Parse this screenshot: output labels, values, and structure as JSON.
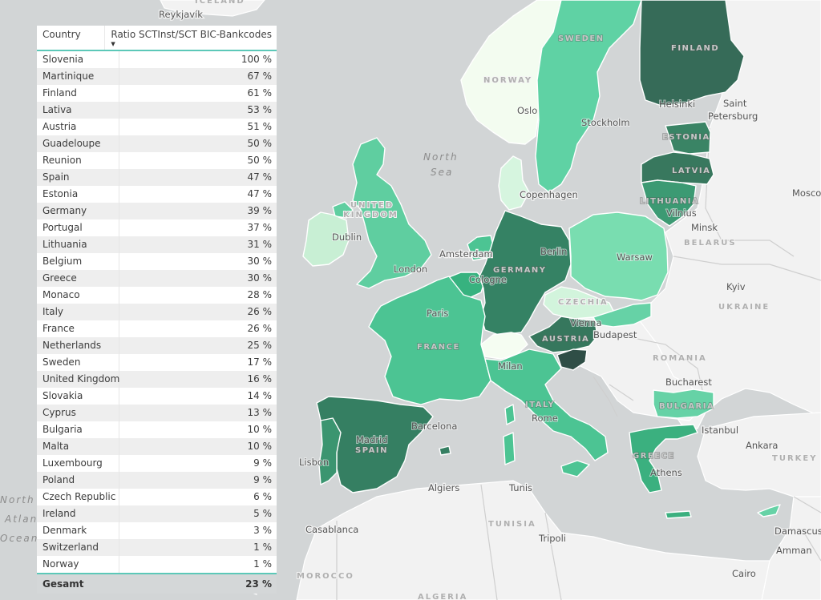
{
  "table": {
    "columns": [
      "Country",
      "Ratio SCTInst/SCT BIC-Bankcodes"
    ],
    "sort_indicator": "sort-descending-icon",
    "rows": [
      {
        "country": "Slovenia",
        "ratio": "100 %"
      },
      {
        "country": "Martinique",
        "ratio": "67 %"
      },
      {
        "country": "Finland",
        "ratio": "61 %"
      },
      {
        "country": "Lativa",
        "ratio": "53 %"
      },
      {
        "country": "Austria",
        "ratio": "51 %"
      },
      {
        "country": "Guadeloupe",
        "ratio": "50 %"
      },
      {
        "country": "Reunion",
        "ratio": "50 %"
      },
      {
        "country": "Spain",
        "ratio": "47 %"
      },
      {
        "country": "Estonia",
        "ratio": "47 %"
      },
      {
        "country": "Germany",
        "ratio": "39 %"
      },
      {
        "country": "Portugal",
        "ratio": "37 %"
      },
      {
        "country": "Lithuania",
        "ratio": "31 %"
      },
      {
        "country": "Belgium",
        "ratio": "30 %"
      },
      {
        "country": "Greece",
        "ratio": "30 %"
      },
      {
        "country": "Monaco",
        "ratio": "28 %"
      },
      {
        "country": "Italy",
        "ratio": "26 %"
      },
      {
        "country": "France",
        "ratio": "26 %"
      },
      {
        "country": "Netherlands",
        "ratio": "25 %"
      },
      {
        "country": "Sweden",
        "ratio": "17 %"
      },
      {
        "country": "United Kingdom",
        "ratio": "16 %"
      },
      {
        "country": "Slovakia",
        "ratio": "14 %"
      },
      {
        "country": "Cyprus",
        "ratio": "13 %"
      },
      {
        "country": "Bulgaria",
        "ratio": "10 %"
      },
      {
        "country": "Malta",
        "ratio": "10 %"
      },
      {
        "country": "Luxembourg",
        "ratio": "9 %"
      },
      {
        "country": "Poland",
        "ratio": "9 %"
      },
      {
        "country": "Czech Republic",
        "ratio": "6 %"
      },
      {
        "country": "Ireland",
        "ratio": "5 %"
      },
      {
        "country": "Denmark",
        "ratio": "3 %"
      },
      {
        "country": "Switzerland",
        "ratio": "1 %"
      },
      {
        "country": "Norway",
        "ratio": "1 %"
      }
    ],
    "total": {
      "label": "Gesamt",
      "ratio": "23 %"
    }
  },
  "map": {
    "color_scale": {
      "low": "#f3fcf3",
      "mid": "#4cc493",
      "high": "#2f5a4d"
    },
    "countries": [
      {
        "id": "norway",
        "label": "NORWAY",
        "value": 1,
        "color": "#f3fcf0"
      },
      {
        "id": "sweden",
        "label": "SWEDEN",
        "value": 17,
        "color": "#5fd2a4"
      },
      {
        "id": "finland",
        "label": "FINLAND",
        "value": 61,
        "color": "#366b58"
      },
      {
        "id": "estonia",
        "label": "ESTONIA",
        "value": 47,
        "color": "#3a8465"
      },
      {
        "id": "latvia",
        "label": "LATVIA",
        "value": 53,
        "color": "#38785e"
      },
      {
        "id": "lithuania",
        "label": "LITHUANIA",
        "value": 31,
        "color": "#3c9a73"
      },
      {
        "id": "denmark",
        "label": "",
        "value": 3,
        "color": "#d6f5df"
      },
      {
        "id": "uk",
        "label": "UNITED KINGDOM",
        "value": 16,
        "color": "#5fcea0"
      },
      {
        "id": "ireland",
        "label": "",
        "value": 5,
        "color": "#c8efd4"
      },
      {
        "id": "netherlands",
        "label": "",
        "value": 25,
        "color": "#4cc493"
      },
      {
        "id": "belgium",
        "label": "",
        "value": 30,
        "color": "#37b27f"
      },
      {
        "id": "germany",
        "label": "GERMANY",
        "value": 39,
        "color": "#358264"
      },
      {
        "id": "poland",
        "label": "",
        "value": 9,
        "color": "#79ddb0"
      },
      {
        "id": "czechia",
        "label": "CZECHIA",
        "value": 6,
        "color": "#d2f4dc"
      },
      {
        "id": "slovakia",
        "label": "",
        "value": 14,
        "color": "#66d2a6"
      },
      {
        "id": "austria",
        "label": "AUSTRIA",
        "value": 51,
        "color": "#36775d"
      },
      {
        "id": "slovenia",
        "label": "",
        "value": 100,
        "color": "#2f4e46"
      },
      {
        "id": "switzerland",
        "label": "",
        "value": 1,
        "color": "#f5fdf2"
      },
      {
        "id": "france",
        "label": "FRANCE",
        "value": 26,
        "color": "#4cc493"
      },
      {
        "id": "italy",
        "label": "ITALY",
        "value": 26,
        "color": "#4cc493"
      },
      {
        "id": "spain",
        "label": "SPAIN",
        "value": 47,
        "color": "#357f62"
      },
      {
        "id": "portugal",
        "label": "",
        "value": 37,
        "color": "#3b9570"
      },
      {
        "id": "greece",
        "label": "GREECE",
        "value": 30,
        "color": "#3bb07f"
      },
      {
        "id": "bulgaria",
        "label": "BULGARIA",
        "value": 10,
        "color": "#66d2a6"
      },
      {
        "id": "cyprus",
        "label": "",
        "value": 13,
        "color": "#66d2a6"
      }
    ],
    "labels": {
      "reykjavik": "Reykjavík",
      "iceland": "ICELAND",
      "oslo": "Oslo",
      "stockholm": "Stockholm",
      "helsinki": "Helsinki",
      "saint_petersburg_1": "Saint",
      "saint_petersburg_2": "Petersburg",
      "moscow": "Mosco",
      "north_sea_1": "North",
      "north_sea_2": "Sea",
      "copenhagen": "Copenhagen",
      "dublin": "Dublin",
      "london": "London",
      "amsterdam": "Amsterdam",
      "berlin": "Berlin",
      "cologne": "Cologne",
      "warsaw": "Warsaw",
      "vilnius": "Vilnius",
      "minsk": "Minsk",
      "belarus": "BELARUS",
      "kyiv": "Kyiv",
      "ukraine": "UKRAINE",
      "paris": "Paris",
      "vienna": "Vienna",
      "budapest": "Budapest",
      "romania": "ROMANIA",
      "milan": "Milan",
      "bucharest": "Bucharest",
      "barcelona": "Barcelona",
      "madrid": "Madrid",
      "rome": "Rome",
      "istanbul": "Istanbul",
      "ankara": "Ankara",
      "turkey": "TURKEY",
      "lisbon": "Lisbon",
      "athens": "Athens",
      "algiers": "Algiers",
      "tunis": "Tunis",
      "casablanca": "Casablanca",
      "tunisia": "TUNISIA",
      "tripoli": "Tripoli",
      "damascus": "Damascus",
      "amman": "Amman",
      "morocco": "MOROCCO",
      "cairo": "Cairo",
      "algeria": "ALGERIA",
      "atlantic_1": "North",
      "atlantic_2": "Atlant",
      "atlantic_3": "Ocean"
    }
  }
}
